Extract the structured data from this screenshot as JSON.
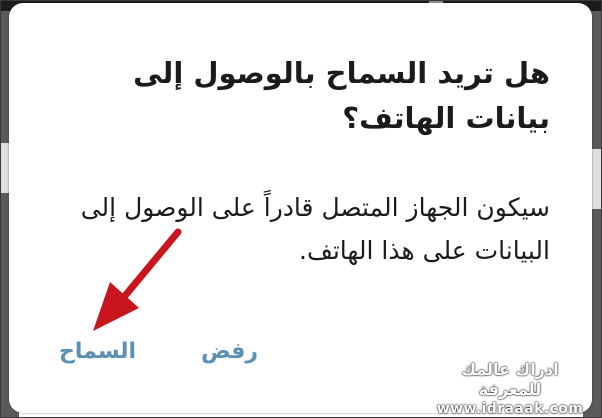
{
  "dialog": {
    "title_lines": [
      "هل تريد السماح بالوصول إلى",
      "بيانات الهاتف؟"
    ],
    "message_lines": [
      "سيكون الجهاز المتصل قادراً على الوصول إلى",
      "البيانات على هذا الهاتف."
    ],
    "buttons": {
      "allow_label": "السماح",
      "deny_label": "رفض"
    }
  },
  "watermark": {
    "line1": "ادراك عالمك للمعرفة",
    "line2": "www.idraaak.com"
  },
  "colors": {
    "button_text": "#5b8fb3",
    "arrow": "#c9151e",
    "backdrop": "#5a5a5a"
  }
}
